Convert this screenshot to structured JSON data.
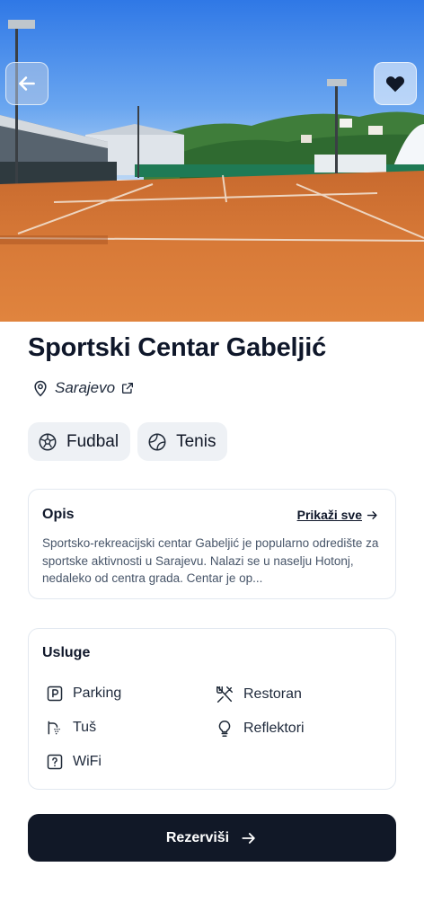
{
  "venue": {
    "name": "Sportski Centar Gabeljić",
    "city": "Sarajevo"
  },
  "sports": [
    {
      "label": "Fudbal",
      "icon": "football-icon"
    },
    {
      "label": "Tenis",
      "icon": "tennis-ball-icon"
    }
  ],
  "description": {
    "heading": "Opis",
    "show_all": "Prikaži sve",
    "text": "Sportsko-rekreacijski centar Gabeljić je popularno odredište za sportske aktivnosti u Sarajevu. Nalazi se u naselju Hotonj, nedaleko od centra grada. Centar je op..."
  },
  "services": {
    "heading": "Usluge",
    "items": [
      {
        "label": "Parking",
        "icon": "parking-icon"
      },
      {
        "label": "Restoran",
        "icon": "utensils-icon"
      },
      {
        "label": "Tuš",
        "icon": "shower-icon"
      },
      {
        "label": "Reflektori",
        "icon": "lightbulb-icon"
      },
      {
        "label": "WiFi",
        "icon": "question-box-icon"
      }
    ]
  },
  "cta": {
    "label": "Rezerviši"
  },
  "colors": {
    "primary": "#111827",
    "chip_bg": "#eef1f5",
    "border": "#e2e8f0",
    "muted_text": "#475569"
  }
}
